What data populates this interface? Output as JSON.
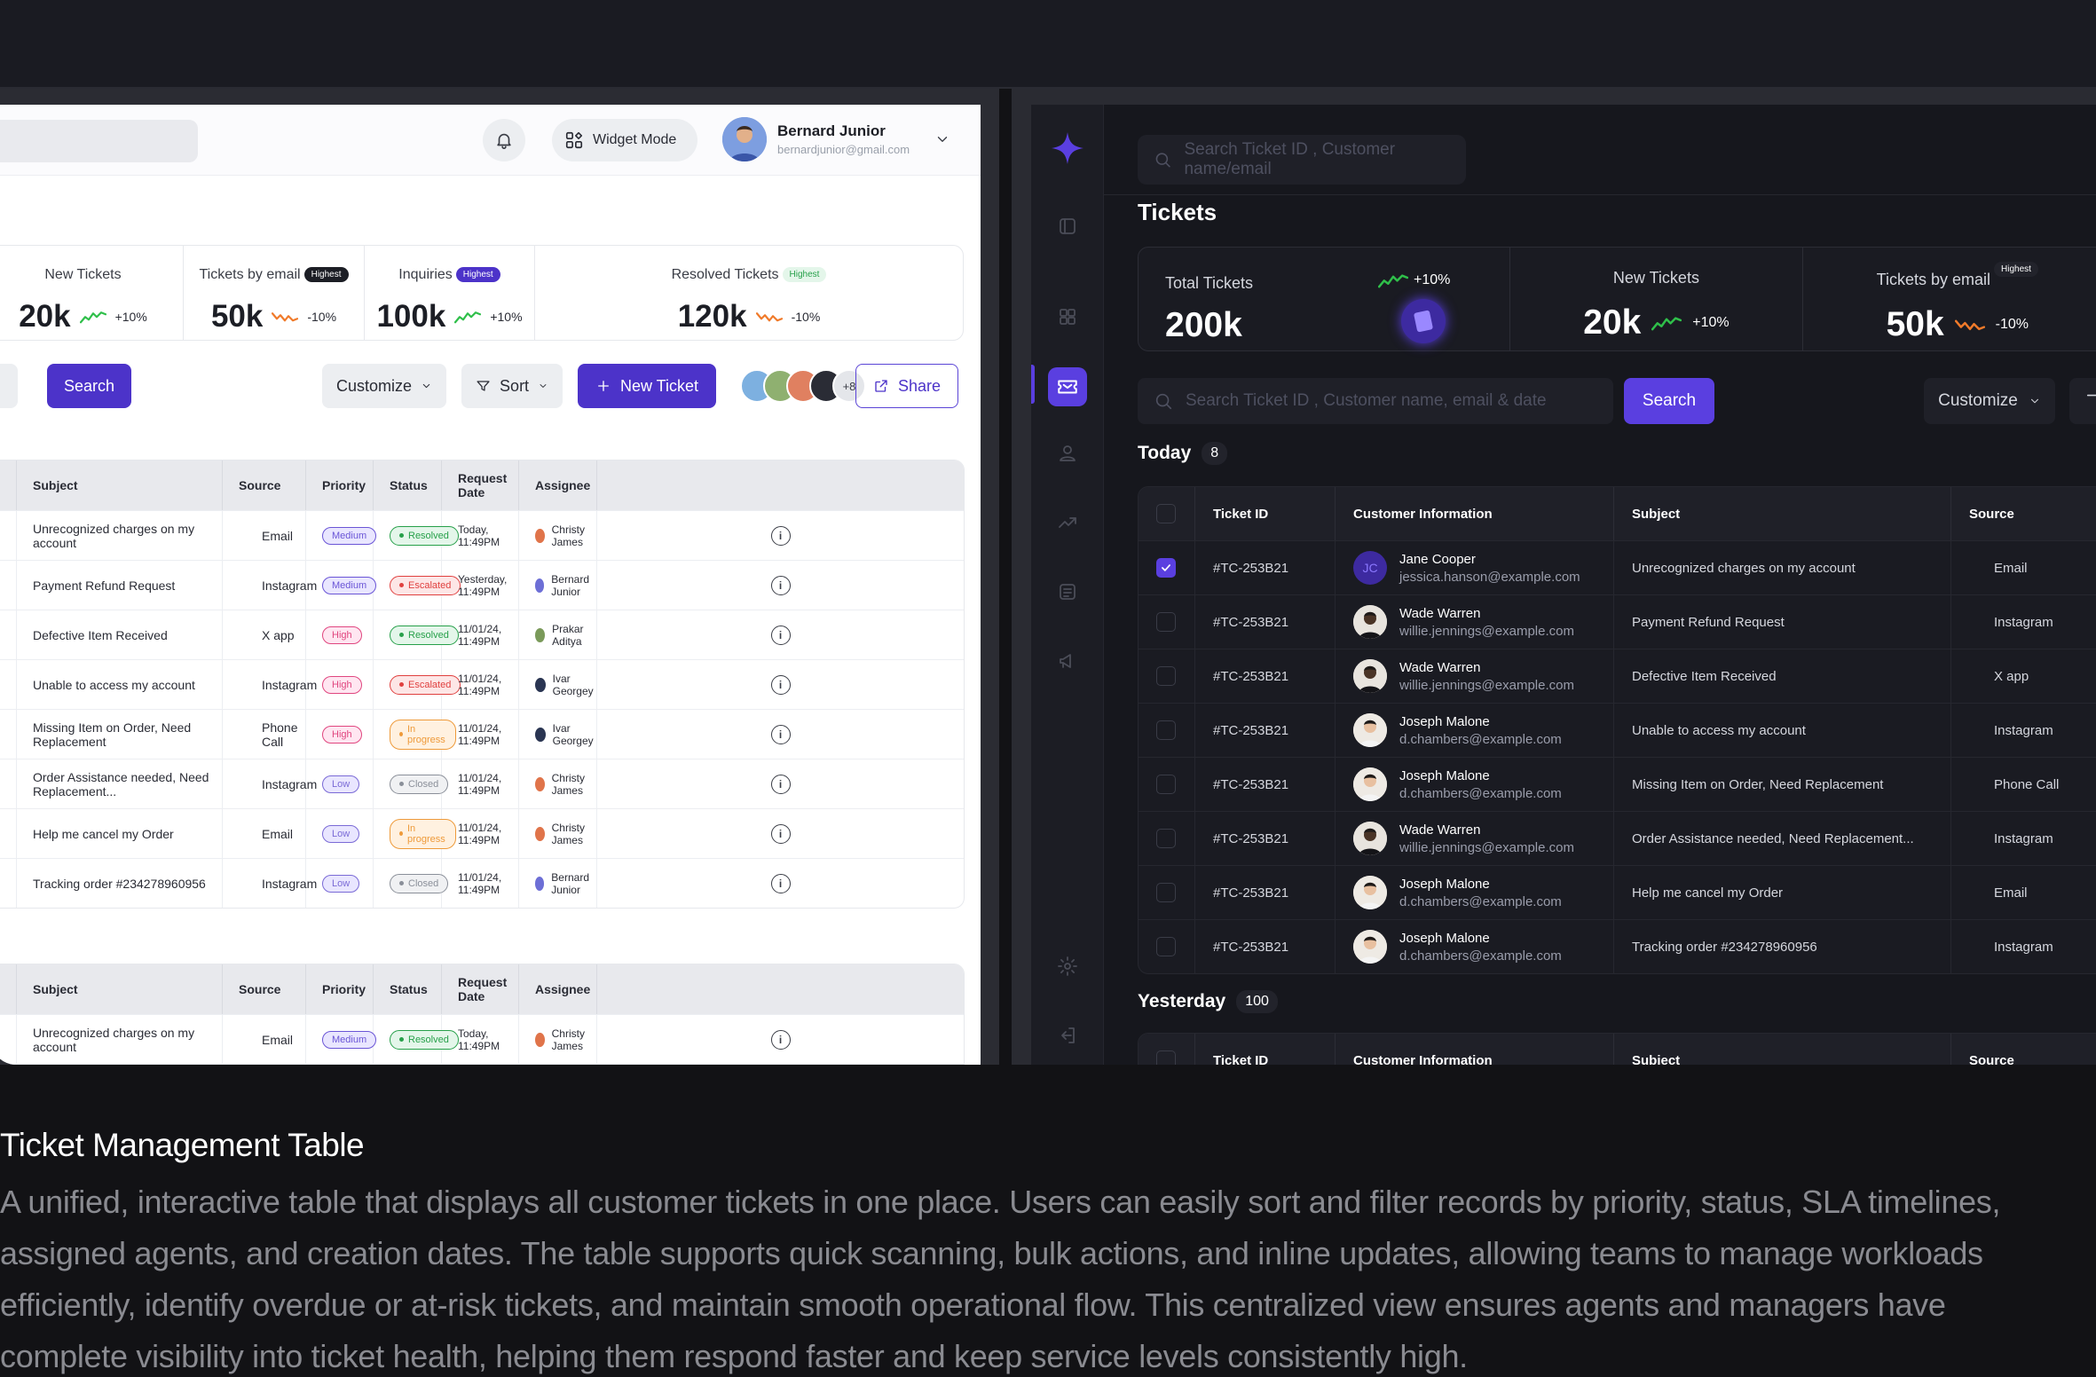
{
  "caption": {
    "title": "Ticket Management Table",
    "body": "A unified, interactive table that displays all customer tickets in one place. Users can easily sort and filter records by priority, status, SLA timelines, assigned agents, and creation dates. The table supports quick scanning, bulk actions, and inline updates, allowing teams to manage workloads efficiently, identify overdue or at-risk tickets, and maintain smooth operational flow. This centralized view ensures agents and managers have complete visibility into ticket health, helping them respond faster and keep service levels consistently high."
  },
  "light": {
    "header": {
      "widget_label": "Widget Mode",
      "user_name": "Bernard Junior",
      "user_email": "bernardjunior@gmail.com"
    },
    "stats": [
      {
        "label": "New Tickets",
        "value": "20k",
        "change": "+10%",
        "trend": "up",
        "badge": ""
      },
      {
        "label": "Tickets by email",
        "value": "50k",
        "change": "-10%",
        "trend": "down",
        "badge": "Highest"
      },
      {
        "label": "Inquiries",
        "value": "100k",
        "change": "+10%",
        "trend": "up",
        "badge": "Highest"
      },
      {
        "label": "Resolved Tickets",
        "value": "120k",
        "change": "-10%",
        "trend": "down",
        "badge": "Highest"
      }
    ],
    "toolbar": {
      "search_partial": "e",
      "search_label": "Search",
      "customize_label": "Customize",
      "sort_label": "Sort",
      "new_ticket_label": "New Ticket",
      "more_count": "+8",
      "share_label": "Share"
    },
    "columns": [
      "Subject",
      "Source",
      "Priority",
      "Status",
      "Request Date",
      "Assignee"
    ],
    "rows": [
      {
        "edge": "om",
        "subject": "Unrecognized charges on my account",
        "source": "Email",
        "source_icon": "mail",
        "priority": "Medium",
        "status": "Resolved",
        "date": "Today, 11:49PM",
        "assignee": "Christy James",
        "acolor": "#e0744a"
      },
      {
        "edge": "m",
        "subject": "Payment Refund Request",
        "source": "Instagram",
        "source_icon": "instagram",
        "priority": "Medium",
        "status": "Escalated",
        "date": "Yesterday, 11:49PM",
        "assignee": "Bernard Junior",
        "acolor": "#6d6fd6"
      },
      {
        "edge": "m",
        "subject": "Defective Item Received",
        "source": "X app",
        "source_icon": "x",
        "priority": "High",
        "status": "Resolved",
        "date": "11/01/24, 11:49PM",
        "assignee": "Prakar Aditya",
        "acolor": "#7a9a5a"
      },
      {
        "edge": "",
        "subject": "Unable to access my account",
        "source": "Instagram",
        "source_icon": "instagram",
        "priority": "High",
        "status": "Escalated",
        "date": "11/01/24, 11:49PM",
        "assignee": "Ivar Georgey",
        "acolor": "#2a3552"
      },
      {
        "edge": "",
        "subject": "Missing Item on Order, Need Replacement",
        "source": "Phone Call",
        "source_icon": "phone",
        "priority": "High",
        "status": "In progress",
        "date": "11/01/24, 11:49PM",
        "assignee": "Ivar Georgey",
        "acolor": "#2a3552"
      },
      {
        "edge": "m",
        "subject": "Order Assistance needed, Need Replacement...",
        "source": "Instagram",
        "source_icon": "instagram",
        "priority": "Low",
        "status": "Closed",
        "date": "11/01/24, 11:49PM",
        "assignee": "Christy James",
        "acolor": "#e0744a"
      },
      {
        "edge": "",
        "subject": "Help me cancel my Order",
        "source": "Email",
        "source_icon": "mail",
        "priority": "Low",
        "status": "In progress",
        "date": "11/01/24, 11:49PM",
        "assignee": "Christy James",
        "acolor": "#e0744a"
      },
      {
        "edge": "",
        "subject": "Tracking order #234278960956",
        "source": "Instagram",
        "source_icon": "instagram",
        "priority": "Low",
        "status": "Closed",
        "date": "11/01/24, 11:49PM",
        "assignee": "Bernard Junior",
        "acolor": "#6d6fd6"
      }
    ],
    "rows2": [
      {
        "edge": "m",
        "subject": "Unrecognized charges on my account",
        "source": "Email",
        "source_icon": "mail",
        "priority": "Medium",
        "status": "Resolved",
        "date": "Today, 11:49PM",
        "assignee": "Christy James",
        "acolor": "#e0744a"
      }
    ]
  },
  "dark": {
    "top_search_placeholder": "Search Ticket ID , Customer name/email",
    "title": "Tickets",
    "stats": [
      {
        "label": "Total Tickets",
        "value": "200k",
        "change": "+10%",
        "trend": "up",
        "badge": ""
      },
      {
        "label": "New Tickets",
        "value": "20k",
        "change": "+10%",
        "trend": "up",
        "badge": ""
      },
      {
        "label": "Tickets by email",
        "value": "50k",
        "change": "-10%",
        "trend": "down",
        "badge": "Highest"
      }
    ],
    "search_placeholder": "Search Ticket ID , Customer name, email & date",
    "search_label": "Search",
    "customize_label": "Customize",
    "today": {
      "label": "Today",
      "count": "8"
    },
    "yesterday": {
      "label": "Yesterday",
      "count": "100"
    },
    "columns": [
      "Ticket ID",
      "Customer Information",
      "Subject",
      "Source"
    ],
    "rows": [
      {
        "checked": true,
        "id": "#TC-253B21",
        "name": "Jane Cooper",
        "email": "jessica.hanson@example.com",
        "avatar": "JC",
        "subject": "Unrecognized charges on my account",
        "source": "Email",
        "source_icon": "mail"
      },
      {
        "checked": false,
        "id": "#TC-253B21",
        "name": "Wade Warren",
        "email": "willie.jennings@example.com",
        "avatar": "dark",
        "subject": "Payment Refund Request",
        "source": "Instagram",
        "source_icon": "instagram"
      },
      {
        "checked": false,
        "id": "#TC-253B21",
        "name": "Wade Warren",
        "email": "willie.jennings@example.com",
        "avatar": "dark",
        "subject": "Defective Item Received",
        "source": "X app",
        "source_icon": "x"
      },
      {
        "checked": false,
        "id": "#TC-253B21",
        "name": "Joseph Malone",
        "email": "d.chambers@example.com",
        "avatar": "light",
        "subject": "Unable to access my account",
        "source": "Instagram",
        "source_icon": "instagram"
      },
      {
        "checked": false,
        "id": "#TC-253B21",
        "name": "Joseph Malone",
        "email": "d.chambers@example.com",
        "avatar": "light",
        "subject": "Missing Item on Order, Need Replacement",
        "source": "Phone Call",
        "source_icon": "phone"
      },
      {
        "checked": false,
        "id": "#TC-253B21",
        "name": "Wade Warren",
        "email": "willie.jennings@example.com",
        "avatar": "dark",
        "subject": "Order Assistance needed, Need Replacement...",
        "source": "Instagram",
        "source_icon": "instagram"
      },
      {
        "checked": false,
        "id": "#TC-253B21",
        "name": "Joseph Malone",
        "email": "d.chambers@example.com",
        "avatar": "light",
        "subject": "Help me cancel my Order",
        "source": "Email",
        "source_icon": "mail"
      },
      {
        "checked": false,
        "id": "#TC-253B21",
        "name": "Joseph Malone",
        "email": "d.chambers@example.com",
        "avatar": "light",
        "subject": "Tracking order #234278960956",
        "source": "Instagram",
        "source_icon": "instagram"
      }
    ]
  },
  "colors": {
    "accent": "#4c33c9",
    "accent_dark": "#5a3fe0",
    "up": "#2fbf4a",
    "down": "#f07a2a",
    "priority": {
      "Medium": [
        "#e9e6ff",
        "#6a55d6"
      ],
      "High": [
        "#ffe6f1",
        "#e0467f"
      ],
      "Low": [
        "#e9e6ff",
        "#7a6ad6"
      ]
    },
    "status": {
      "Resolved": [
        "#e4f6ea",
        "#27a04a"
      ],
      "Escalated": [
        "#fde6e6",
        "#e0403f"
      ],
      "In progress": [
        "#fff1e0",
        "#ee9a3a"
      ],
      "Closed": [
        "#f0f1f3",
        "#8a8f99"
      ]
    }
  }
}
